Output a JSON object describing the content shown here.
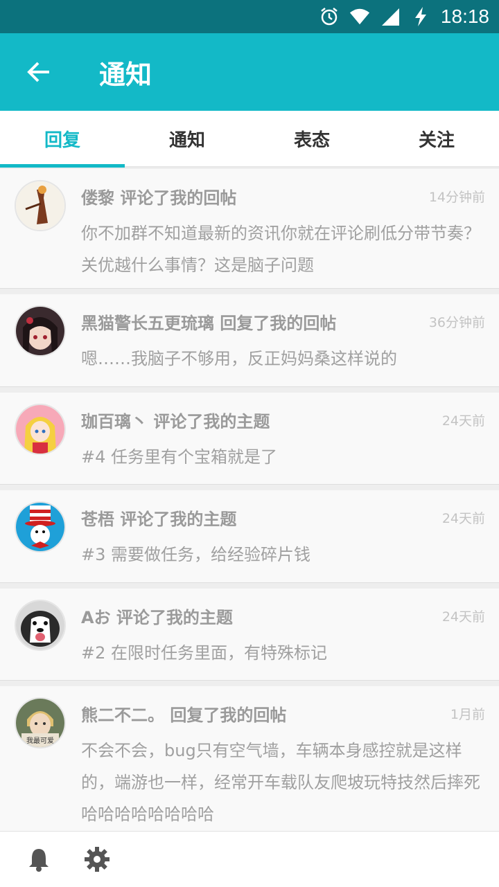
{
  "status_bar": {
    "time": "18:18"
  },
  "app_bar": {
    "title": "通知"
  },
  "tabs": [
    {
      "label": "回复",
      "active": true
    },
    {
      "label": "通知",
      "active": false
    },
    {
      "label": "表态",
      "active": false
    },
    {
      "label": "关注",
      "active": false
    }
  ],
  "notifications": [
    {
      "author": "偻黎 评论了我的回帖",
      "time": "14分钟前",
      "content": "你不加群不知道最新的资讯你就在评论刷低分带节奏？关优越什么事情？这是脑子问题"
    },
    {
      "author": "黑猫警长五更琉璃 回复了我的回帖",
      "time": "36分钟前",
      "content": "嗯……我脑子不够用，反正妈妈桑这样说的"
    },
    {
      "author": "珈百璃丶 评论了我的主题",
      "time": "24天前",
      "content": "#4 任务里有个宝箱就是了"
    },
    {
      "author": "苍梧 评论了我的主题",
      "time": "24天前",
      "content": "#3 需要做任务，给经验碎片钱"
    },
    {
      "author": "Aお 评论了我的主题",
      "time": "24天前",
      "content": "#2 在限时任务里面，有特殊标记"
    },
    {
      "author": "熊二不二。 回复了我的回帖",
      "time": "1月前",
      "content": "不会不会，bug只有空气墙，车辆本身感控就是这样的，端游也一样，经常开车载队友爬坡玩特技然后摔死哈哈哈哈哈哈哈哈",
      "avatar_text": "我最可爱"
    }
  ],
  "colors": {
    "accent": "#13b9c7",
    "status_bar": "#0c727d"
  }
}
